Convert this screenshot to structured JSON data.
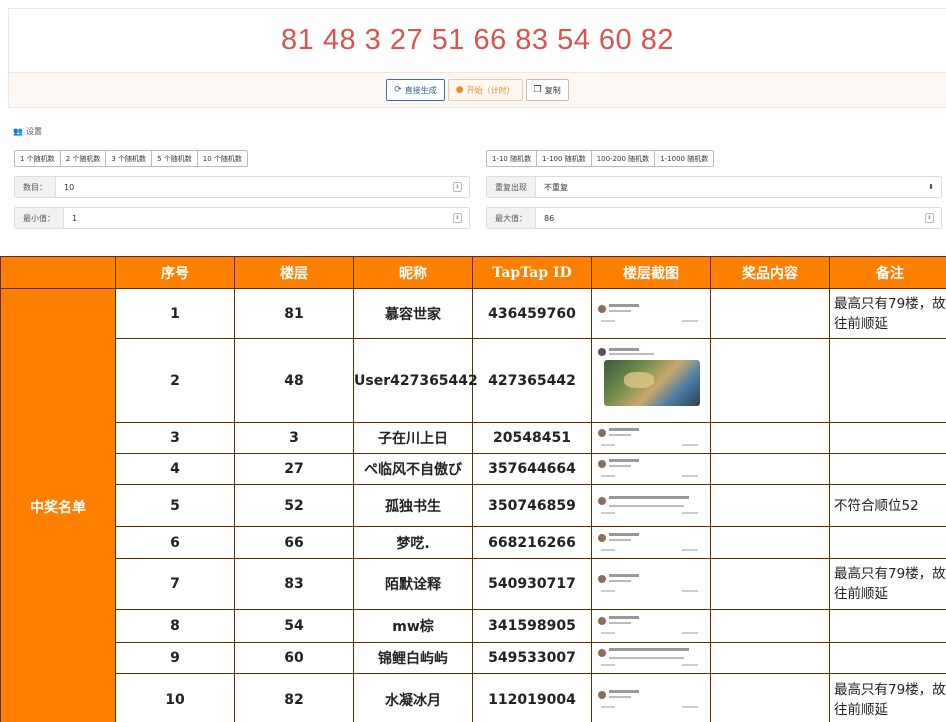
{
  "generator": {
    "result_text": "81 48 3 27 51 66 83 54 60 82",
    "buttons": {
      "direct_generate": "直接生成",
      "start": "开始（计时）",
      "copy": "复制"
    }
  },
  "settings": {
    "title": "设置",
    "count_presets": [
      "1 个随机数",
      "2 个随机数",
      "3 个随机数",
      "5 个随机数",
      "10 个随机数"
    ],
    "range_presets": [
      "1-10 随机数",
      "1-100 随机数",
      "100-200 随机数",
      "1-1000 随机数"
    ],
    "count": {
      "label": "数目：",
      "value": "10"
    },
    "repeat": {
      "label": "重复出现",
      "value": "不重复"
    },
    "min": {
      "label": "最小值：",
      "value": "1"
    },
    "max": {
      "label": "最大值：",
      "value": "86"
    }
  },
  "winners": {
    "side_label": "中奖名单",
    "columns": [
      "序号",
      "楼层",
      "昵称",
      "TapTap ID",
      "楼层截图",
      "奖品内容",
      "备注"
    ],
    "rows": [
      {
        "no": "1",
        "floor": "81",
        "nickname": "慕容世家",
        "taptap_id": "436459760",
        "prize": "",
        "note": "最高只有79楼，故往前顺延"
      },
      {
        "no": "2",
        "floor": "48",
        "nickname": "User427365442",
        "taptap_id": "427365442",
        "prize": "",
        "note": ""
      },
      {
        "no": "3",
        "floor": "3",
        "nickname": "子在川上日",
        "taptap_id": "20548451",
        "prize": "",
        "note": ""
      },
      {
        "no": "4",
        "floor": "27",
        "nickname": "ペ临风不自傲び",
        "taptap_id": "357644664",
        "prize": "",
        "note": ""
      },
      {
        "no": "5",
        "floor": "52",
        "nickname": "孤独书生",
        "taptap_id": "350746859",
        "prize": "",
        "note": "不符合顺位52"
      },
      {
        "no": "6",
        "floor": "66",
        "nickname": "梦呓.",
        "taptap_id": "668216266",
        "prize": "",
        "note": ""
      },
      {
        "no": "7",
        "floor": "83",
        "nickname": "陌默诠释",
        "taptap_id": "540930717",
        "prize": "",
        "note": "最高只有79楼，故往前顺延"
      },
      {
        "no": "8",
        "floor": "54",
        "nickname": "mw棕",
        "taptap_id": "341598905",
        "prize": "",
        "note": ""
      },
      {
        "no": "9",
        "floor": "60",
        "nickname": "锦鲤白屿屿",
        "taptap_id": "549533007",
        "prize": "",
        "note": ""
      },
      {
        "no": "10",
        "floor": "82",
        "nickname": "水凝冰月",
        "taptap_id": "112019004",
        "prize": "",
        "note": "最高只有79楼，故往前顺延"
      }
    ]
  }
}
